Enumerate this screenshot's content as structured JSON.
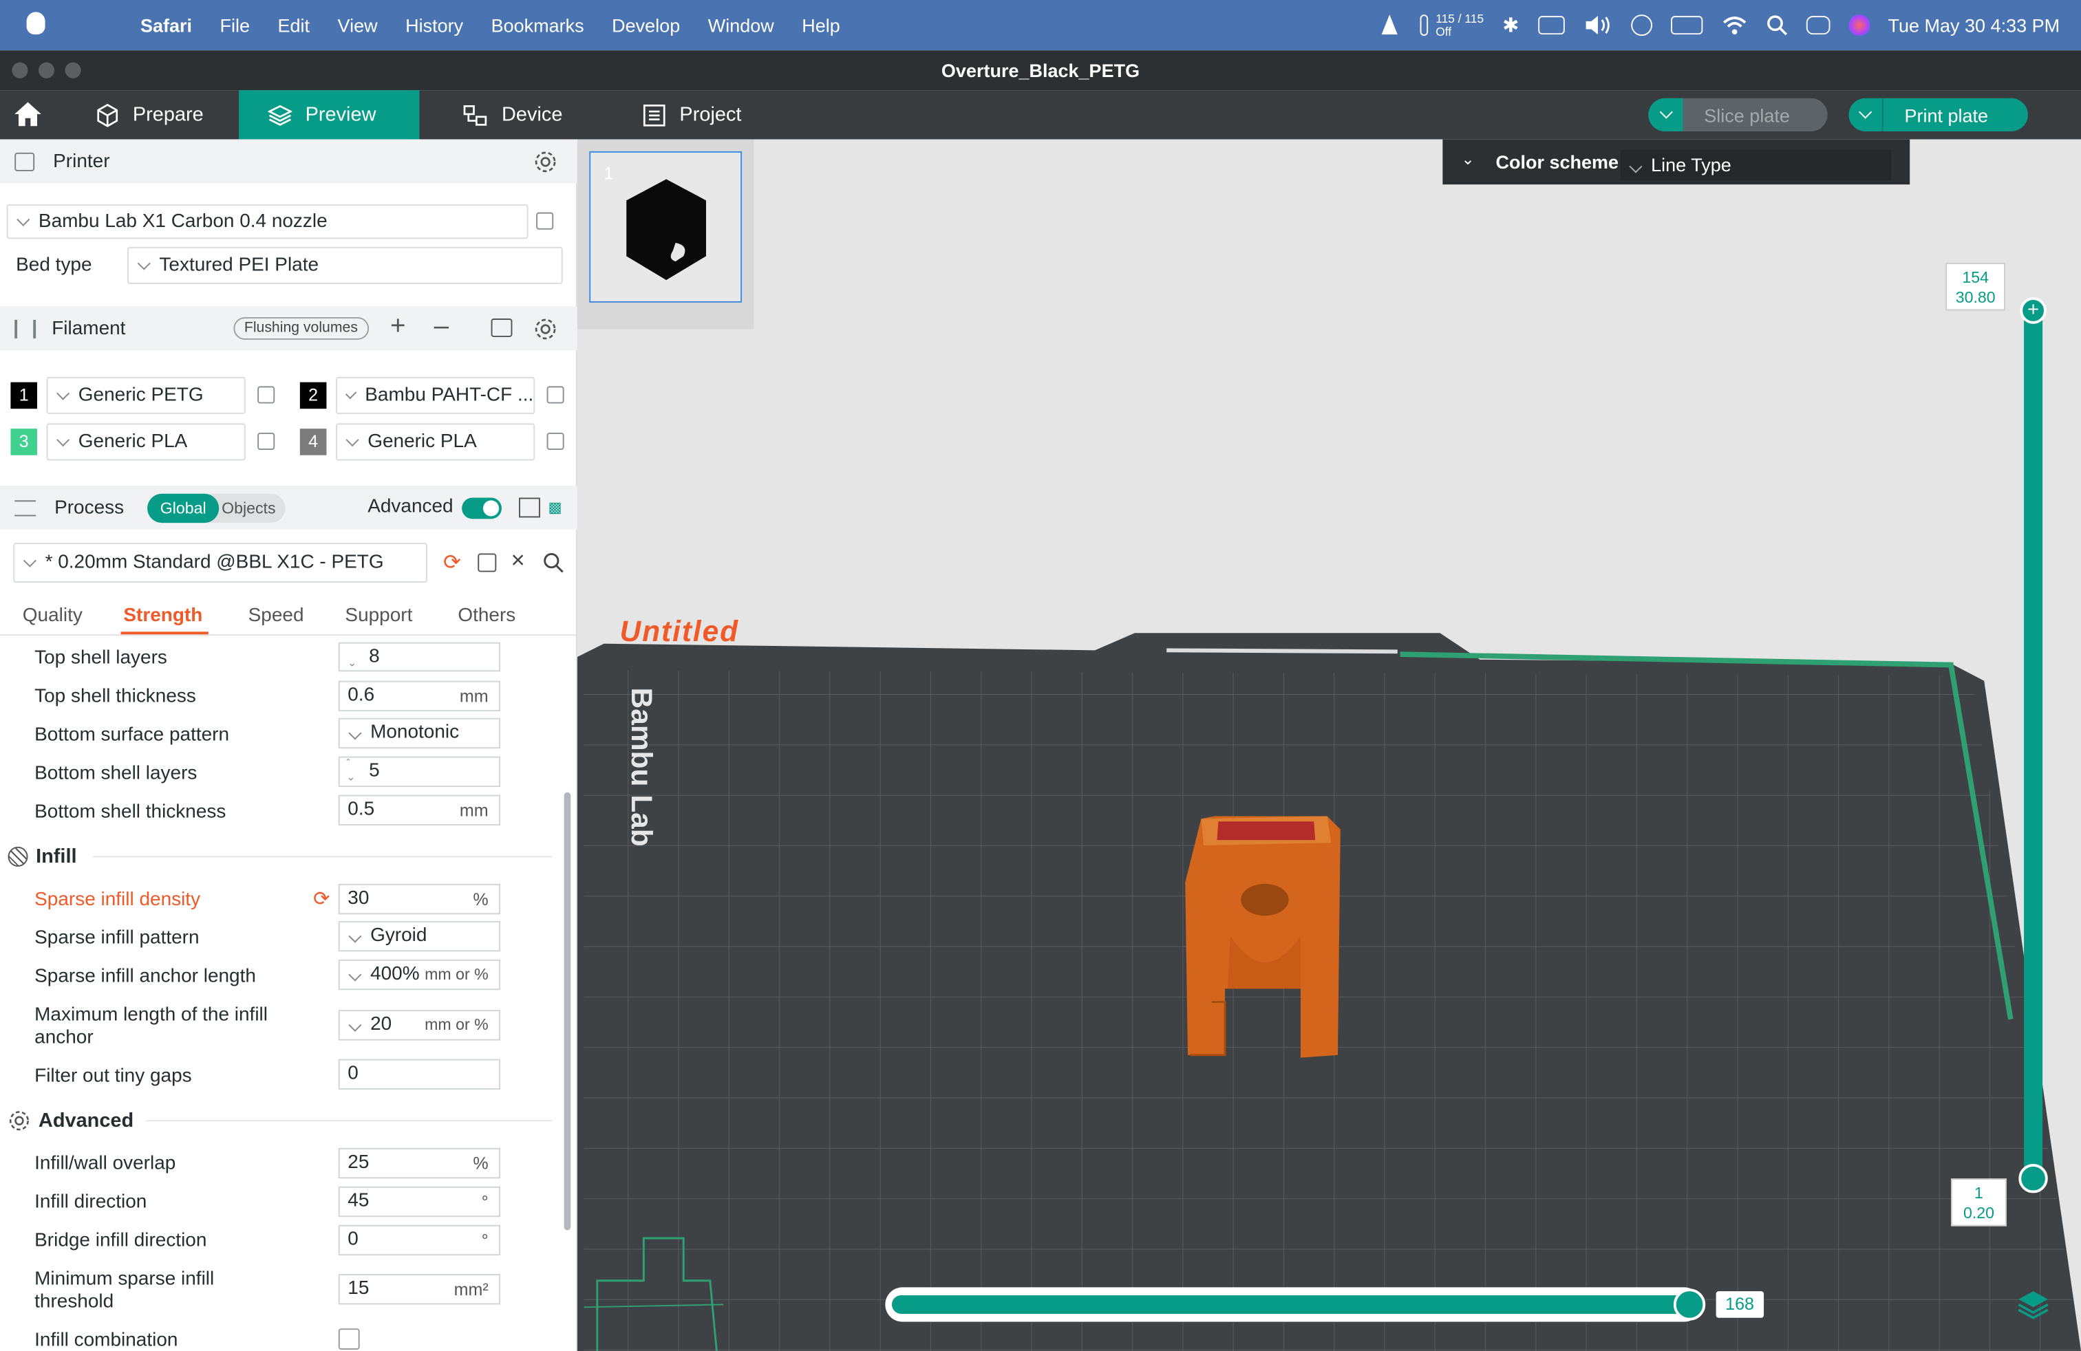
{
  "menubar": {
    "app": "Safari",
    "items": [
      "File",
      "Edit",
      "View",
      "History",
      "Bookmarks",
      "Develop",
      "Window",
      "Help"
    ],
    "battery_text_1": "115 / 115",
    "battery_text_2": "Off",
    "clock": "Tue May 30  4:33 PM"
  },
  "window": {
    "title": "Overture_Black_PETG"
  },
  "toptabs": {
    "prepare": "Prepare",
    "preview": "Preview",
    "device": "Device",
    "project": "Project"
  },
  "buttons": {
    "slice": "Slice plate",
    "print": "Print plate"
  },
  "printer": {
    "header": "Printer",
    "model": "Bambu Lab X1 Carbon 0.4 nozzle",
    "bed_label": "Bed type",
    "bed_value": "Textured PEI Plate"
  },
  "filament": {
    "header": "Filament",
    "flush": "Flushing volumes",
    "slots": [
      {
        "num": "1",
        "name": "Generic PETG",
        "color": "#000000"
      },
      {
        "num": "2",
        "name": "Bambu PAHT-CF ...",
        "color": "#000000"
      },
      {
        "num": "3",
        "name": "Generic PLA",
        "color": "#41d18e"
      },
      {
        "num": "4",
        "name": "Generic PLA",
        "color": "#7c7c7c"
      }
    ]
  },
  "process": {
    "header": "Process",
    "global": "Global",
    "objects": "Objects",
    "advanced": "Advanced",
    "preset": "* 0.20mm Standard @BBL X1C - PETG",
    "tabs": [
      "Quality",
      "Strength",
      "Speed",
      "Support",
      "Others"
    ]
  },
  "settings": {
    "top_shell_layers": {
      "label": "Top shell layers",
      "value": "8"
    },
    "top_shell_thickness": {
      "label": "Top shell thickness",
      "value": "0.6",
      "unit": "mm"
    },
    "bottom_surface_pattern": {
      "label": "Bottom surface pattern",
      "value": "Monotonic"
    },
    "bottom_shell_layers": {
      "label": "Bottom shell layers",
      "value": "5"
    },
    "bottom_shell_thickness": {
      "label": "Bottom shell thickness",
      "value": "0.5",
      "unit": "mm"
    },
    "infill_header": "Infill",
    "sparse_infill_density": {
      "label": "Sparse infill density",
      "value": "30",
      "unit": "%"
    },
    "sparse_infill_pattern": {
      "label": "Sparse infill pattern",
      "value": "Gyroid"
    },
    "anchor_length": {
      "label": "Sparse infill anchor length",
      "value": "400%",
      "unit": "mm or %"
    },
    "max_anchor": {
      "label_1": "Maximum length of the infill",
      "label_2": "anchor",
      "value": "20",
      "unit": "mm or %"
    },
    "filter_gaps": {
      "label": "Filter out tiny gaps",
      "value": "0"
    },
    "advanced_header": "Advanced",
    "infill_wall_overlap": {
      "label": "Infill/wall overlap",
      "value": "25",
      "unit": "%"
    },
    "infill_direction": {
      "label": "Infill direction",
      "value": "45",
      "unit": "°"
    },
    "bridge_direction": {
      "label": "Bridge infill direction",
      "value": "0",
      "unit": "°"
    },
    "min_sparse": {
      "label_1": "Minimum sparse infill",
      "label_2": "threshold",
      "value": "15",
      "unit": "mm²"
    },
    "infill_combination": {
      "label": "Infill combination"
    }
  },
  "viewport": {
    "plate_number": "1",
    "color_scheme_label": "Color scheme",
    "color_scheme_value": "Line Type",
    "bed_title": "Untitled",
    "bed_brand": "Bambu Lab",
    "layer_top_num": "154",
    "layer_top_height": "30.80",
    "layer_bottom_num": "1",
    "layer_bottom_height": "0.20",
    "h_slider_value": "168"
  },
  "colors": {
    "accent": "#079c88",
    "orange": "#f05a28",
    "menubar": "#4a73b1"
  }
}
